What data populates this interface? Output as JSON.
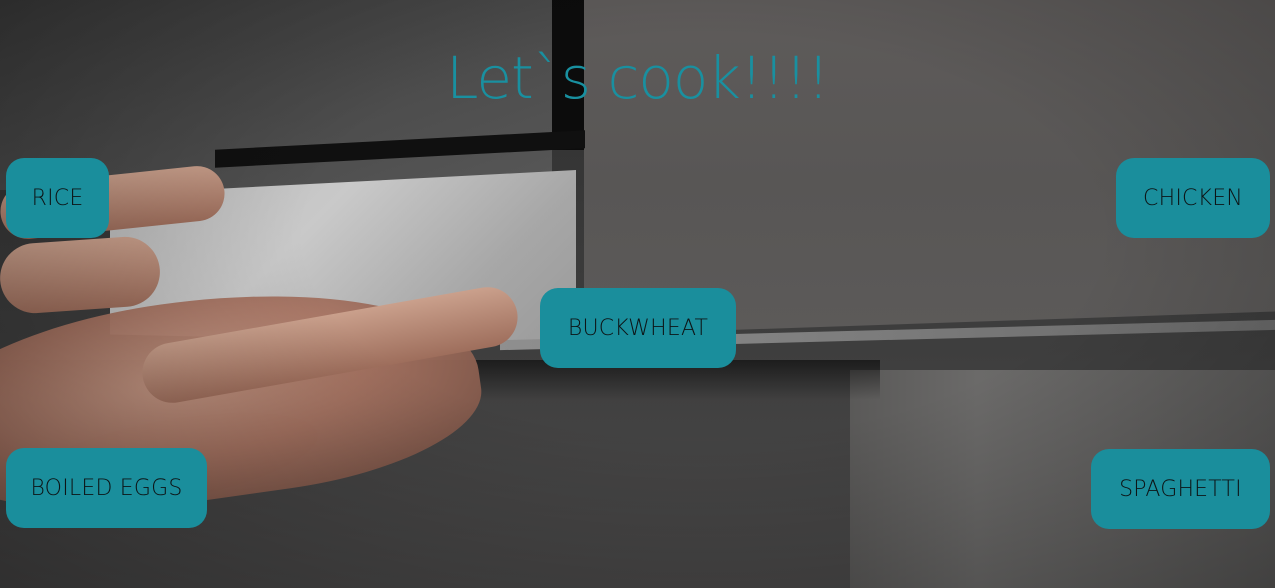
{
  "page": {
    "title": "Let`s cook!!!!",
    "title_color": "#1990a0"
  },
  "dishes": [
    {
      "label": "RICE"
    },
    {
      "label": "CHICKEN"
    },
    {
      "label": "BUCKWHEAT"
    },
    {
      "label": "BOILED EGGS"
    },
    {
      "label": "SPAGHETTI"
    }
  ],
  "theme": {
    "button_color": "#1a8e9c",
    "button_text_color": "#0d1416"
  }
}
